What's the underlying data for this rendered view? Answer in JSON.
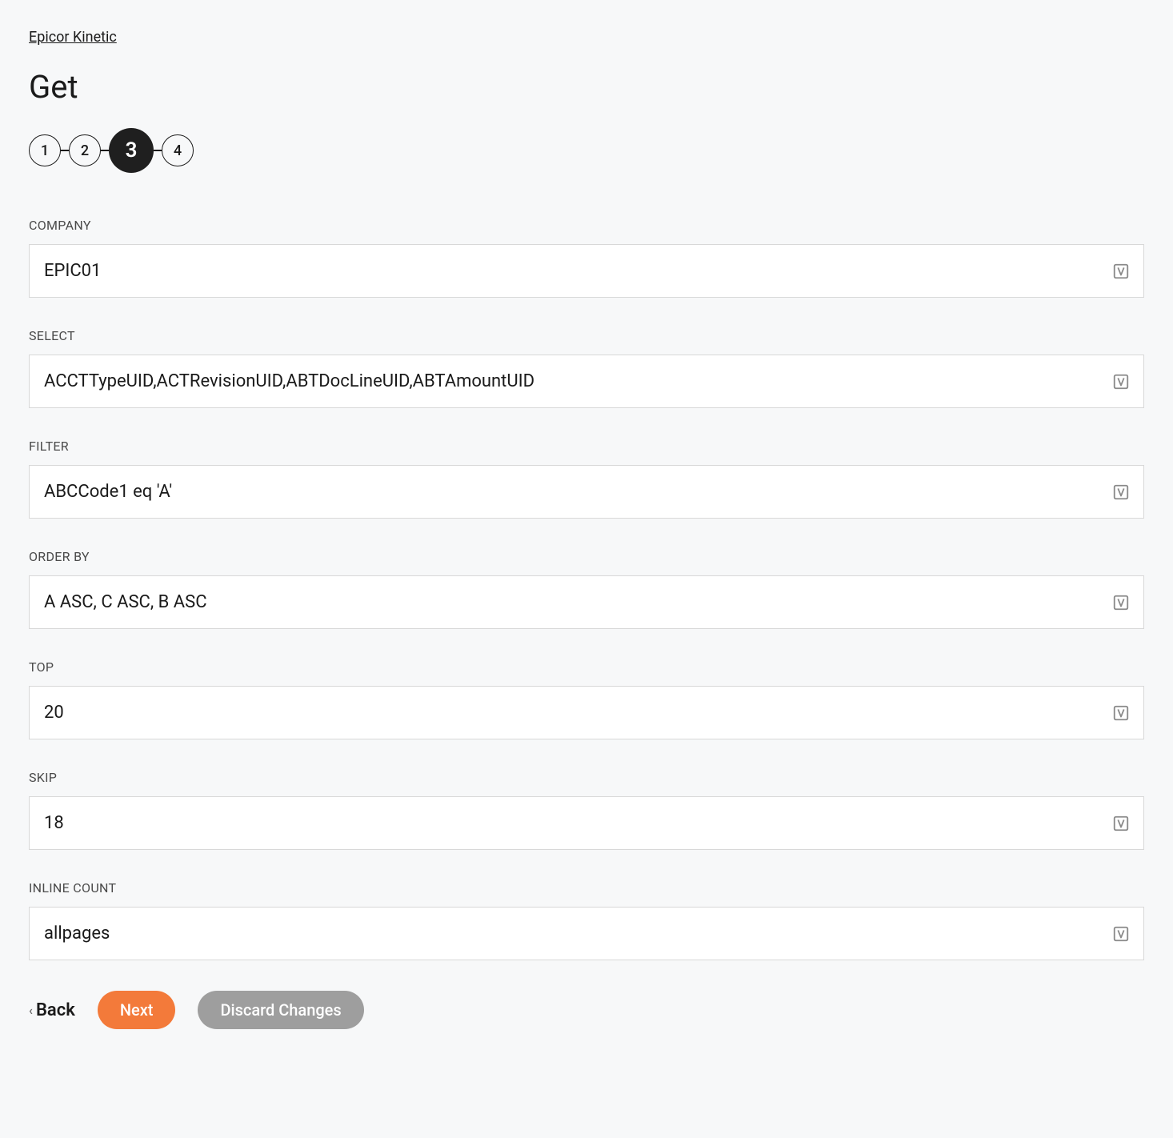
{
  "breadcrumb": "Epicor Kinetic",
  "title": "Get",
  "stepper": {
    "steps": [
      "1",
      "2",
      "3",
      "4"
    ],
    "activeIndex": 2
  },
  "fields": {
    "company": {
      "label": "COMPANY",
      "value": "EPIC01"
    },
    "select": {
      "label": "SELECT",
      "value": "ACCTTypeUID,ACTRevisionUID,ABTDocLineUID,ABTAmountUID"
    },
    "filter": {
      "label": "FILTER",
      "value": "ABCCode1 eq 'A'"
    },
    "orderby": {
      "label": "ORDER BY",
      "value": "A ASC, C ASC, B ASC"
    },
    "top": {
      "label": "TOP",
      "value": "20"
    },
    "skip": {
      "label": "SKIP",
      "value": "18"
    },
    "inlinecount": {
      "label": "INLINE COUNT",
      "value": "allpages"
    }
  },
  "buttons": {
    "back": "Back",
    "next": "Next",
    "discard": "Discard Changes"
  }
}
